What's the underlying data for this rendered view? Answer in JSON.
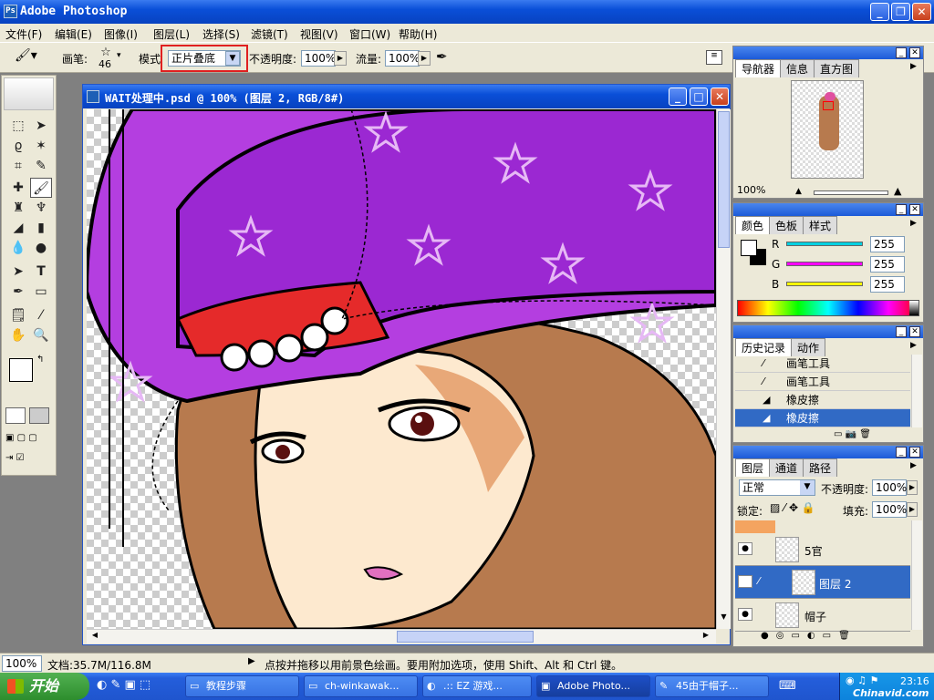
{
  "app": {
    "title": "Adobe Photoshop"
  },
  "menu": [
    "文件(F)",
    "编辑(E)",
    "图像(I)",
    "图层(L)",
    "选择(S)",
    "滤镜(T)",
    "视图(V)",
    "窗口(W)",
    "帮助(H)"
  ],
  "options": {
    "brush_label": "画笔:",
    "brush_size": "46",
    "mode_label": "模式",
    "mode_value": "正片叠底",
    "opacity_label": "不透明度:",
    "opacity_value": "100%",
    "flow_label": "流量:",
    "flow_value": "100%"
  },
  "document": {
    "title": "WAIT处理中.psd @ 100% (图层 2, RGB/8#)"
  },
  "navigator": {
    "tabs": [
      "导航器",
      "信息",
      "直方图"
    ],
    "zoom": "100%"
  },
  "color": {
    "tabs": [
      "颜色",
      "色板",
      "样式"
    ],
    "channels": [
      {
        "name": "R",
        "value": "255",
        "color": "#00d0e0"
      },
      {
        "name": "G",
        "value": "255",
        "color": "#ff00ff"
      },
      {
        "name": "B",
        "value": "255",
        "color": "#ffff00"
      }
    ]
  },
  "history": {
    "tabs": [
      "历史记录",
      "动作"
    ],
    "items": [
      "画笔工具",
      "画笔工具",
      "橡皮擦",
      "橡皮擦"
    ]
  },
  "layers": {
    "tabs": [
      "图层",
      "通道",
      "路径"
    ],
    "blend_mode": "正常",
    "opacity_label": "不透明度:",
    "opacity_value": "100%",
    "lock_label": "锁定:",
    "fill_label": "填充:",
    "fill_value": "100%",
    "items": [
      "5官",
      "图层 2",
      "帽子"
    ]
  },
  "status": {
    "zoom": "100%",
    "doc": "文档:35.7M/116.8M",
    "hint": "点按并拖移以用前景色绘画。要用附加选项，使用 Shift、Alt 和 Ctrl 键。"
  },
  "taskbar": {
    "start": "开始",
    "tasks": [
      "教程步骤",
      "ch-winkawak...",
      ".:: EZ 游戏...",
      "Adobe Photo...",
      "45由于帽子..."
    ],
    "clock": "23:16",
    "watermark": "Chinavid.com"
  }
}
